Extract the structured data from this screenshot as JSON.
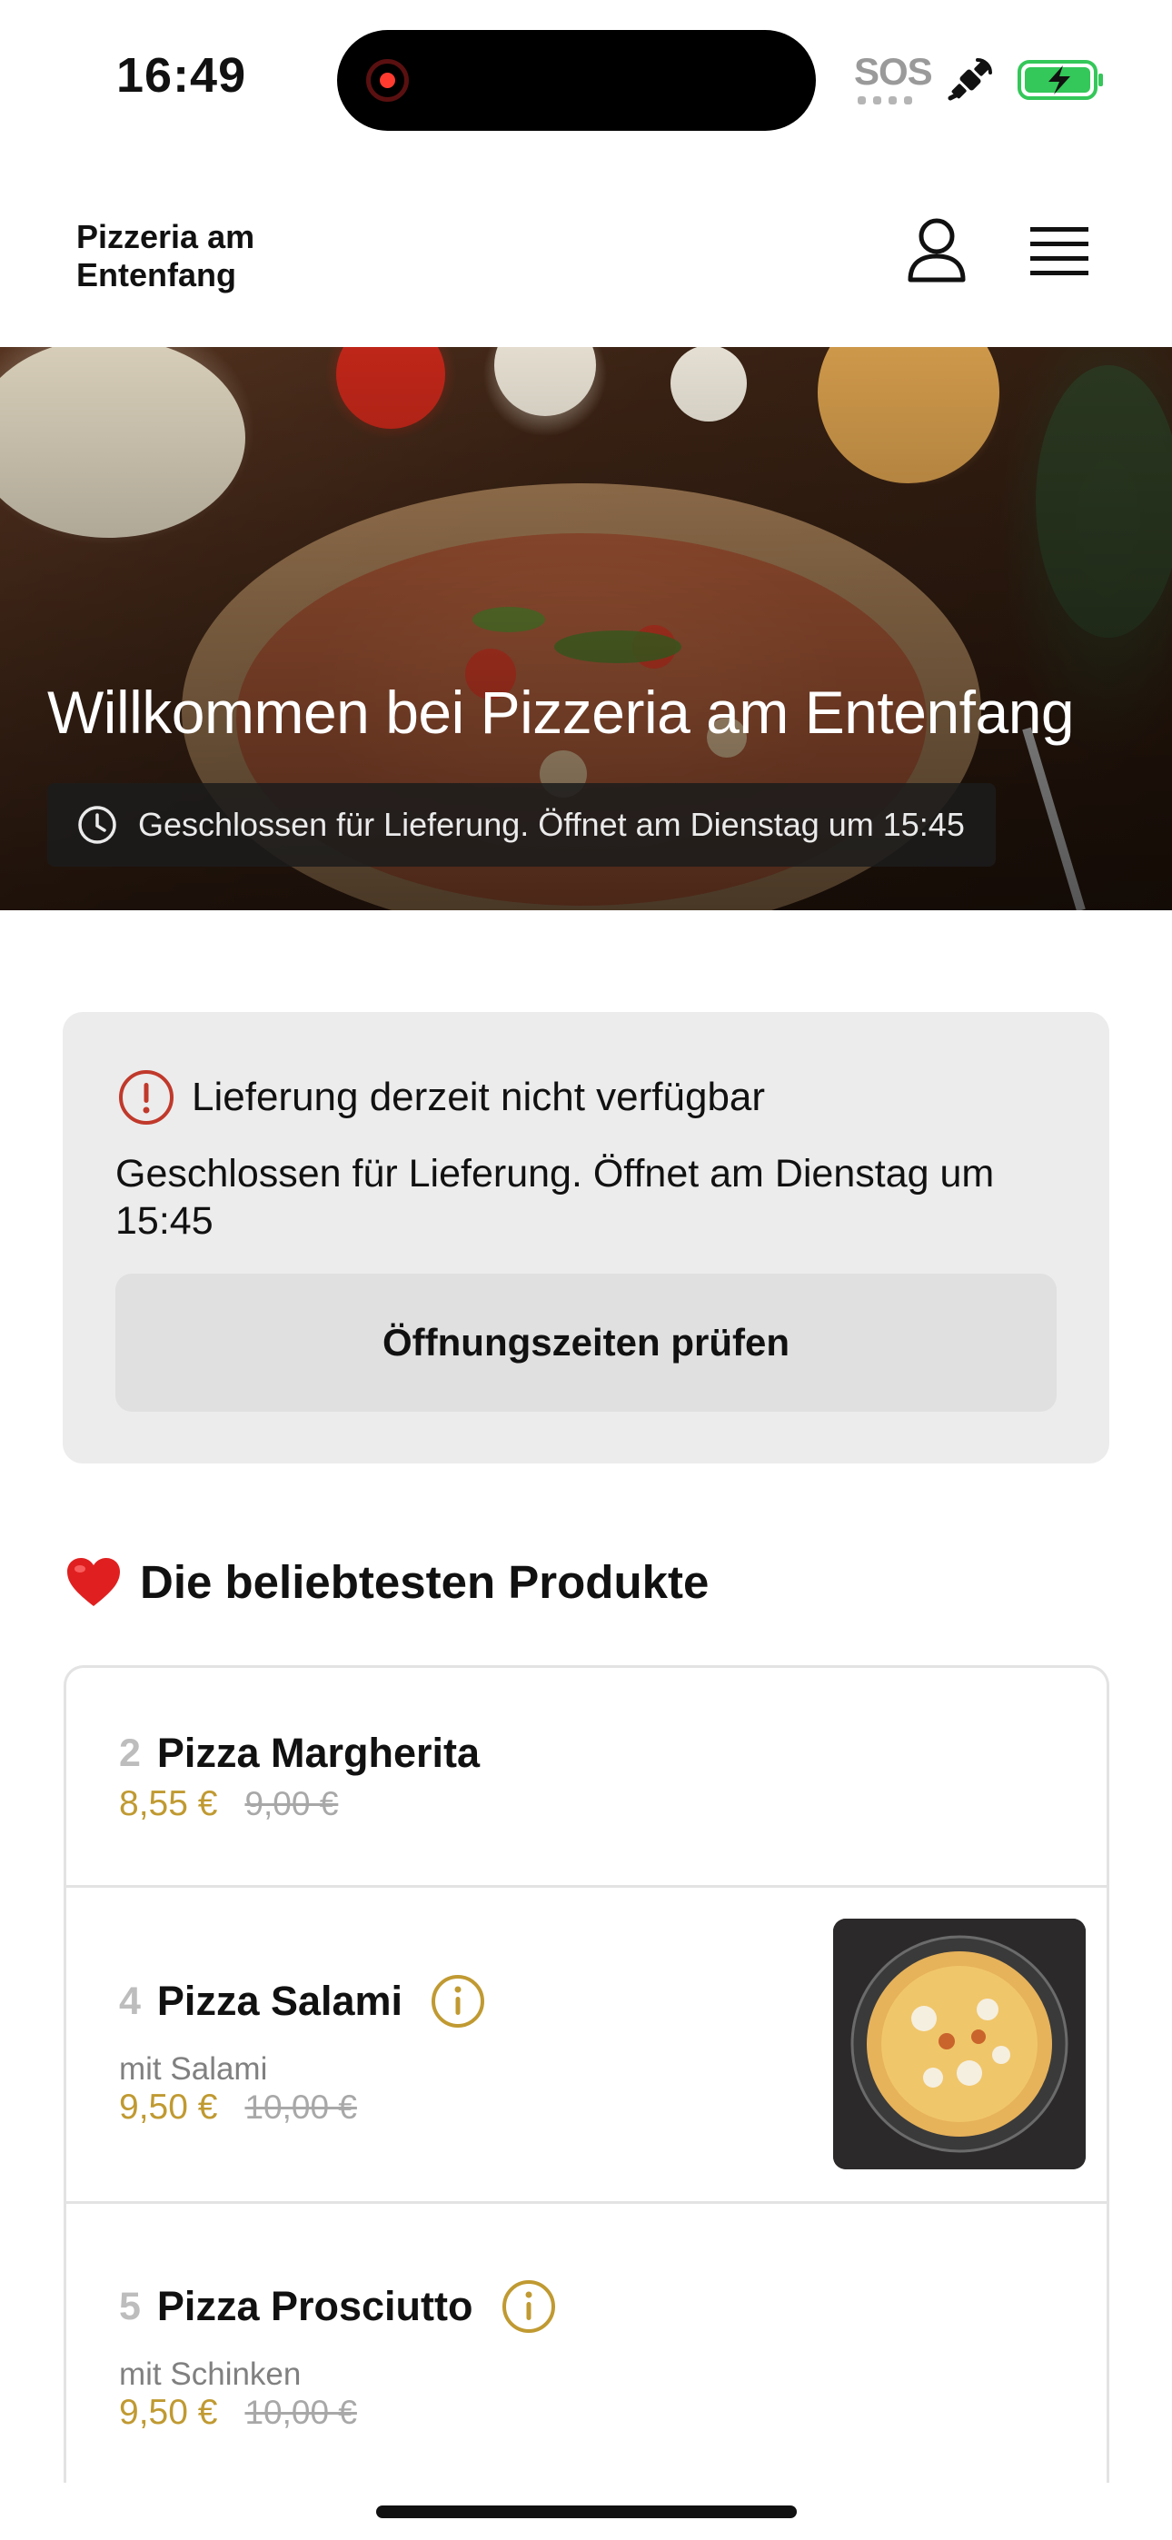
{
  "status_bar": {
    "time": "16:49",
    "sos": "SOS",
    "recording_color": "#ff3b30",
    "battery_color": "#34c759"
  },
  "header": {
    "brand": "Pizzeria am Entenfang",
    "user_icon": "user-icon",
    "menu_icon": "hamburger-menu-icon"
  },
  "hero": {
    "title": "Willkommen bei Pizzeria am Entenfang",
    "status": "Geschlossen für Lieferung. Öffnet am Dienstag um 15:45",
    "status_icon": "clock-icon"
  },
  "notice": {
    "title": "Lieferung derzeit nicht verfügbar",
    "body": "Geschlossen für Lieferung. Öffnet am Dienstag um 15:45",
    "button": "Öffnungszeiten prüfen",
    "icon": "warning-info-icon",
    "icon_color": "#c0392b"
  },
  "popular": {
    "title": "Die beliebtesten Produkte",
    "emoji": "❤️",
    "items": [
      {
        "number": "2",
        "name": "Pizza Margherita",
        "description": "",
        "price": "8,55 €",
        "old_price": "9,00 €"
      },
      {
        "number": "4",
        "name": "Pizza Salami",
        "description": "mit Salami",
        "price": "9,50 €",
        "old_price": "10,00 €"
      },
      {
        "number": "5",
        "name": "Pizza Prosciutto",
        "description": "mit Schinken",
        "price": "9,50 €",
        "old_price": "10,00 €"
      }
    ]
  },
  "colors": {
    "price": "#c09a32",
    "accent_info": "#c09a32"
  }
}
